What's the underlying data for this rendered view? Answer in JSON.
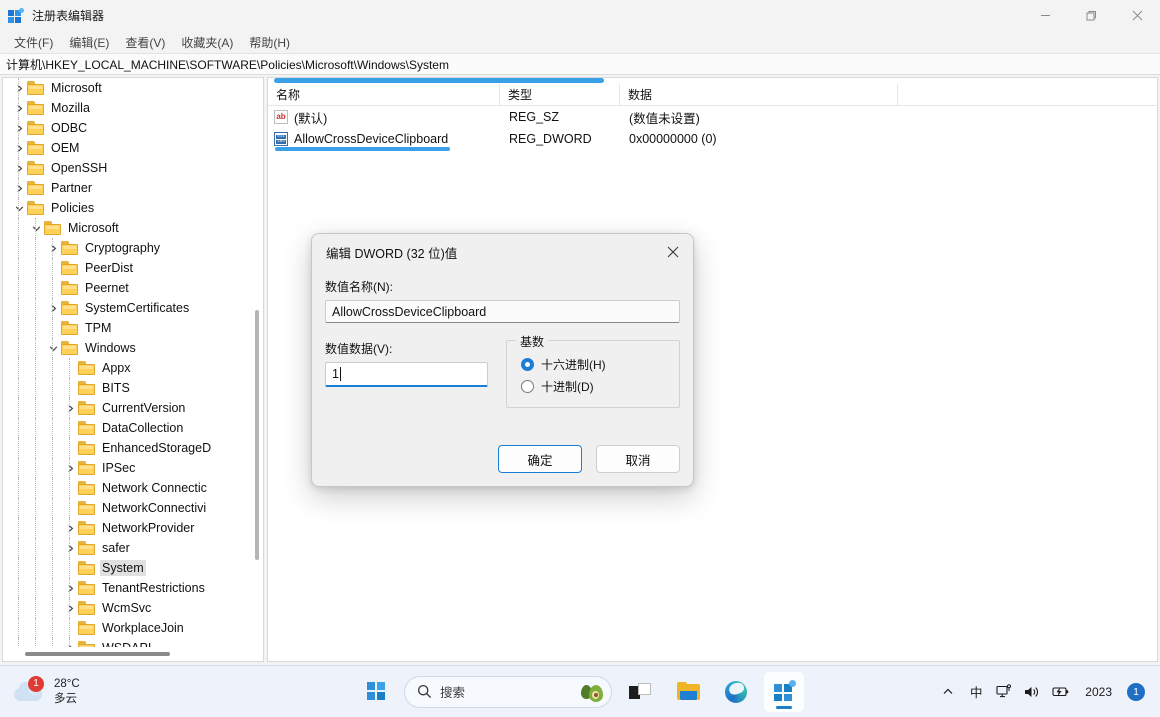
{
  "window": {
    "title": "注册表编辑器",
    "app_icon": "registry-icon",
    "controls": {
      "minimize": "minimize-icon",
      "restore": "restore-icon",
      "close": "close-icon"
    },
    "menu": [
      {
        "label": "文件(F)"
      },
      {
        "label": "编辑(E)"
      },
      {
        "label": "查看(V)"
      },
      {
        "label": "收藏夹(A)"
      },
      {
        "label": "帮助(H)"
      }
    ],
    "address": "计算机\\HKEY_LOCAL_MACHINE\\SOFTWARE\\Policies\\Microsoft\\Windows\\System"
  },
  "tree": [
    {
      "label": "Microsoft",
      "indent": 1,
      "expander": "collapsed",
      "selected": false
    },
    {
      "label": "Mozilla",
      "indent": 1,
      "expander": "collapsed",
      "selected": false
    },
    {
      "label": "ODBC",
      "indent": 1,
      "expander": "collapsed",
      "selected": false
    },
    {
      "label": "OEM",
      "indent": 1,
      "expander": "collapsed",
      "selected": false
    },
    {
      "label": "OpenSSH",
      "indent": 1,
      "expander": "collapsed",
      "selected": false
    },
    {
      "label": "Partner",
      "indent": 1,
      "expander": "collapsed",
      "selected": false
    },
    {
      "label": "Policies",
      "indent": 1,
      "expander": "expanded",
      "selected": false
    },
    {
      "label": "Microsoft",
      "indent": 2,
      "expander": "expanded",
      "selected": false
    },
    {
      "label": "Cryptography",
      "indent": 3,
      "expander": "collapsed",
      "selected": false
    },
    {
      "label": "PeerDist",
      "indent": 3,
      "expander": "none",
      "selected": false
    },
    {
      "label": "Peernet",
      "indent": 3,
      "expander": "none",
      "selected": false
    },
    {
      "label": "SystemCertificates",
      "indent": 3,
      "expander": "collapsed",
      "selected": false
    },
    {
      "label": "TPM",
      "indent": 3,
      "expander": "none",
      "selected": false
    },
    {
      "label": "Windows",
      "indent": 3,
      "expander": "expanded",
      "selected": false
    },
    {
      "label": "Appx",
      "indent": 4,
      "expander": "none",
      "selected": false
    },
    {
      "label": "BITS",
      "indent": 4,
      "expander": "none",
      "selected": false
    },
    {
      "label": "CurrentVersion",
      "indent": 4,
      "expander": "collapsed",
      "selected": false
    },
    {
      "label": "DataCollection",
      "indent": 4,
      "expander": "none",
      "selected": false
    },
    {
      "label": "EnhancedStorageD",
      "indent": 4,
      "expander": "none",
      "selected": false
    },
    {
      "label": "IPSec",
      "indent": 4,
      "expander": "collapsed",
      "selected": false
    },
    {
      "label": "Network Connectic",
      "indent": 4,
      "expander": "none",
      "selected": false
    },
    {
      "label": "NetworkConnectivi",
      "indent": 4,
      "expander": "none",
      "selected": false
    },
    {
      "label": "NetworkProvider",
      "indent": 4,
      "expander": "collapsed",
      "selected": false
    },
    {
      "label": "safer",
      "indent": 4,
      "expander": "collapsed",
      "selected": false
    },
    {
      "label": "System",
      "indent": 4,
      "expander": "none",
      "selected": true
    },
    {
      "label": "TenantRestrictions",
      "indent": 4,
      "expander": "collapsed",
      "selected": false
    },
    {
      "label": "WcmSvc",
      "indent": 4,
      "expander": "collapsed",
      "selected": false
    },
    {
      "label": "WorkplaceJoin",
      "indent": 4,
      "expander": "none",
      "selected": false
    },
    {
      "label": "WSDAPI",
      "indent": 4,
      "expander": "collapsed",
      "selected": false
    }
  ],
  "list": {
    "columns": [
      {
        "label": "名称"
      },
      {
        "label": "类型"
      },
      {
        "label": "数据"
      }
    ],
    "rows": [
      {
        "name": "(默认)",
        "type": "REG_SZ",
        "data": "(数值未设置)",
        "icon": "string-value-icon",
        "selected": false
      },
      {
        "name": "AllowCrossDeviceClipboard",
        "type": "REG_DWORD",
        "data": "0x00000000 (0)",
        "icon": "dword-value-icon",
        "selected": true
      }
    ]
  },
  "dialog": {
    "title": "编辑 DWORD (32 位)值",
    "close_icon": "close-icon",
    "name_label": "数值名称(N):",
    "name_value": "AllowCrossDeviceClipboard",
    "data_label": "数值数据(V):",
    "data_value": "1",
    "base_legend": "基数",
    "base_options": [
      {
        "label": "十六进制(H)",
        "checked": true
      },
      {
        "label": "十进制(D)",
        "checked": false
      }
    ],
    "ok_label": "确定",
    "cancel_label": "取消"
  },
  "taskbar": {
    "weather": {
      "temperature": "28°C",
      "condition": "多云",
      "badge": "1",
      "icon": "cloud-icon"
    },
    "start": "start-button",
    "search_placeholder": "搜索",
    "search_icon": "search-icon",
    "search_accent_icon": "avocado-icon",
    "apps": [
      {
        "name": "task-view",
        "active": false
      },
      {
        "name": "file-explorer",
        "active": false
      },
      {
        "name": "edge-browser",
        "active": false
      },
      {
        "name": "registry-editor",
        "active": true
      }
    ],
    "tray": {
      "chevron": "chevron-up-icon",
      "ime": "中",
      "network": "network-icon",
      "volume": "volume-icon",
      "battery": "battery-icon",
      "time": "2023",
      "notifications": "1"
    }
  },
  "colors": {
    "accent": "#1a7fd4",
    "selection": "#3aa0e8",
    "folder": "#ffd158",
    "badge_red": "#e03a32"
  }
}
